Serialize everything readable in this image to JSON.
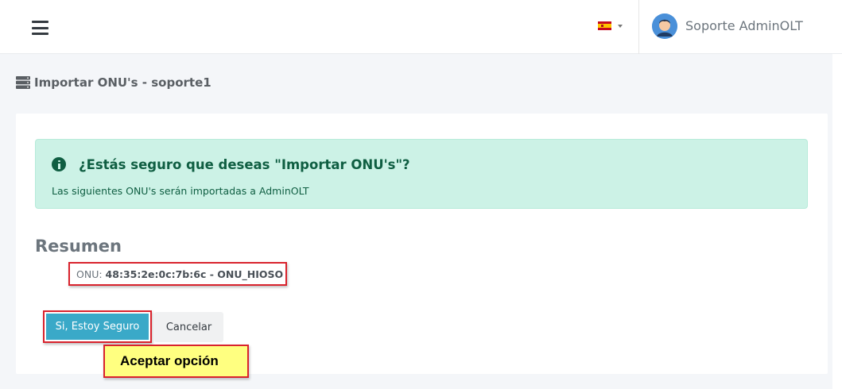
{
  "header": {
    "menu_icon": "hamburger-icon",
    "language_flag": "spain-flag-icon",
    "user_name": "Soporte AdminOLT",
    "avatar_icon": "user-avatar-icon"
  },
  "page": {
    "title_icon": "server-icon",
    "title": "Importar ONU's - soporte1"
  },
  "alert": {
    "icon": "info-circle-icon",
    "title": "¿Estás seguro que deseas \"Importar ONU's\"?",
    "description": "Las siguientes ONU's serán importadas a AdminOLT"
  },
  "summary": {
    "heading": "Resumen",
    "onu_label": "ONU:",
    "onu_value": "48:35:2e:0c:7b:6c - ONU_HIOSO"
  },
  "actions": {
    "confirm_label": "Si, Estoy Seguro",
    "cancel_label": "Cancelar"
  },
  "annotation": {
    "callout_text": "Aceptar opción"
  },
  "colors": {
    "alert_bg": "#ccf2e6",
    "alert_text": "#0f5e42",
    "confirm_button": "#3aa9c8",
    "highlight_border": "#d9232d",
    "callout_bg": "#ffff80"
  }
}
